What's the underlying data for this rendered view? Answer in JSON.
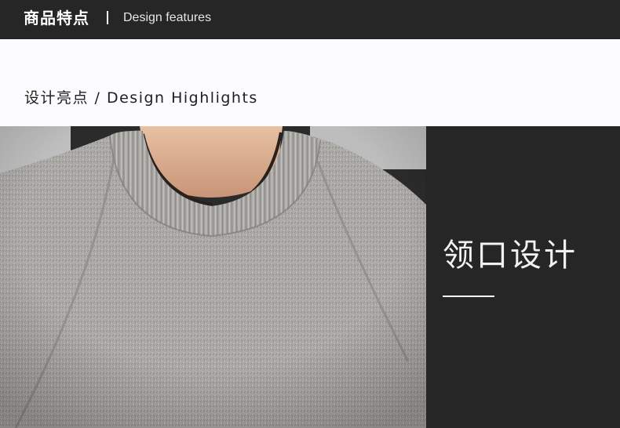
{
  "header": {
    "title_cn": "商品特点",
    "title_en": "Design features"
  },
  "highlights": {
    "title": "设计亮点 / Design Highlights"
  },
  "feature": {
    "photo_subject": "sweater-neckline-photo",
    "title": "领口设计"
  },
  "colors": {
    "header_bg": "#262626",
    "panel_bg": "#262626",
    "band_bg": "#fcfcff",
    "sweater_grey": "#b3b1ae"
  }
}
